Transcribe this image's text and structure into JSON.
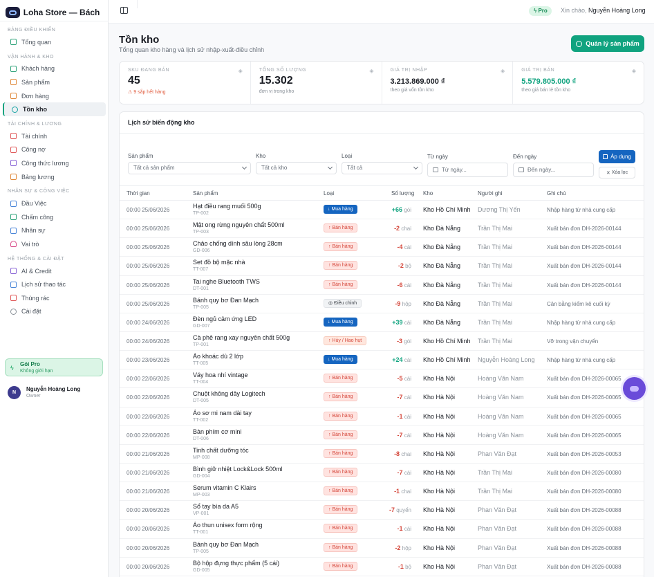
{
  "app": {
    "brand": "Loha Store — Bách hóa ..."
  },
  "sidebar": {
    "sections": [
      {
        "title": "BẢNG ĐIỀU KHIỂN",
        "items": [
          {
            "label": "Tổng quan",
            "icon": "grid-icon",
            "color": "ic-g"
          }
        ]
      },
      {
        "title": "VẬN HÀNH & KHO",
        "items": [
          {
            "label": "Khách hàng",
            "icon": "users-icon",
            "color": "ic-g"
          },
          {
            "label": "Sản phẩm",
            "icon": "box-icon",
            "color": "ic-o"
          },
          {
            "label": "Đơn hàng",
            "icon": "cart-icon",
            "color": "ic-o"
          },
          {
            "label": "Tồn kho",
            "icon": "warehouse-icon",
            "color": "ic-t",
            "active": true
          }
        ]
      },
      {
        "title": "TÀI CHÍNH & LƯƠNG",
        "items": [
          {
            "label": "Tài chính",
            "icon": "wallet-icon",
            "color": "ic-r"
          },
          {
            "label": "Công nợ",
            "icon": "receipt-icon",
            "color": "ic-r"
          },
          {
            "label": "Công thức lương",
            "icon": "formula-icon",
            "color": "ic-p"
          },
          {
            "label": "Bảng lương",
            "icon": "payroll-icon",
            "color": "ic-o"
          }
        ]
      },
      {
        "title": "NHÂN SỰ & CÔNG VIỆC",
        "items": [
          {
            "label": "Đầu Việc",
            "icon": "task-icon",
            "color": "ic-b"
          },
          {
            "label": "Chấm công",
            "icon": "calendar-icon",
            "color": "ic-g"
          },
          {
            "label": "Nhân sự",
            "icon": "people-icon",
            "color": "ic-b"
          },
          {
            "label": "Vai trò",
            "icon": "shield-icon",
            "color": "ic-pk"
          }
        ]
      },
      {
        "title": "HỆ THỐNG & CÀI ĐẶT",
        "items": [
          {
            "label": "AI & Credit",
            "icon": "sparkle-icon",
            "color": "ic-p"
          },
          {
            "label": "Lịch sử thao tác",
            "icon": "history-icon",
            "color": "ic-b"
          },
          {
            "label": "Thùng rác",
            "icon": "trash-icon",
            "color": "ic-r"
          },
          {
            "label": "Cài đặt",
            "icon": "gear-icon",
            "color": "ic-gr"
          }
        ]
      }
    ],
    "plan": {
      "title": "Gói Pro",
      "subtitle": "Không giới hạn"
    },
    "user": {
      "initial": "N",
      "name": "Nguyễn Hoàng Long",
      "role": "Owner"
    }
  },
  "topbar": {
    "pro_badge": "Pro",
    "greeting": "Xin chào,",
    "user_name": "Nguyễn Hoàng Long"
  },
  "page": {
    "title": "Tồn kho",
    "subtitle": "Tổng quan kho hàng và lịch sử nhập-xuất-điều chỉnh",
    "manage_button": "Quản lý sản phẩm"
  },
  "stats": [
    {
      "label": "SKU ĐANG BÁN",
      "value": "45",
      "sub": "9 sắp hết hàng",
      "icon": "cube-icon",
      "warn": true
    },
    {
      "label": "TỔNG SỐ LƯỢNG",
      "value": "15.302",
      "sub": "đơn vị trong kho",
      "icon": "layers-icon"
    },
    {
      "label": "GIÁ TRỊ NHẬP",
      "value": "3.213.869.000 ₫",
      "sub": "theo giá vốn tồn kho",
      "icon": "dollar-icon",
      "small": true
    },
    {
      "label": "GIÁ TRỊ BÁN",
      "value": "5.579.805.000 ₫",
      "sub": "theo giá bán lẻ tồn kho",
      "icon": "trend-up-icon",
      "small": true,
      "green": true
    }
  ],
  "history": {
    "title": "Lịch sử biến động kho",
    "filters": {
      "product_label": "Sản phẩm",
      "product_value": "Tất cả sản phẩm",
      "warehouse_label": "Kho",
      "warehouse_value": "Tất cả kho",
      "type_label": "Loại",
      "type_value": "Tất cả",
      "from_label": "Từ ngày",
      "from_placeholder": "Từ ngày...",
      "to_label": "Đến ngày",
      "to_placeholder": "Đến ngày...",
      "apply": "Áp dụng",
      "clear": "Xóa lọc"
    },
    "columns": [
      "Thời gian",
      "Sản phẩm",
      "Loại",
      "Số lượng",
      "Kho",
      "Người ghi",
      "Ghi chú"
    ],
    "rows": [
      {
        "time": "00:00 25/06/2026",
        "product": "Hạt điều rang muối 500g",
        "sku": "TP-002",
        "type": "Mua hàng",
        "kind": "buy",
        "qty": "+66",
        "unit": "gói",
        "wh": "Kho Hồ Chí Minh",
        "who": "Dương Thị Yến",
        "note": "Nhập hàng từ nhà cung cấp"
      },
      {
        "time": "00:00 25/06/2026",
        "product": "Mật ong rừng nguyên chất 500ml",
        "sku": "TP-003",
        "type": "Bán hàng",
        "kind": "sell",
        "qty": "-2",
        "unit": "chai",
        "wh": "Kho Đà Nẵng",
        "who": "Trần Thị Mai",
        "note": "Xuất bán đơn DH-2026-00144"
      },
      {
        "time": "00:00 25/06/2026",
        "product": "Chảo chống dính sâu lòng 28cm",
        "sku": "GD-006",
        "type": "Bán hàng",
        "kind": "sell",
        "qty": "-4",
        "unit": "cái",
        "wh": "Kho Đà Nẵng",
        "who": "Trần Thị Mai",
        "note": "Xuất bán đơn DH-2026-00144"
      },
      {
        "time": "00:00 25/06/2026",
        "product": "Set đồ bộ mặc nhà",
        "sku": "TT-007",
        "type": "Bán hàng",
        "kind": "sell",
        "qty": "-2",
        "unit": "bộ",
        "wh": "Kho Đà Nẵng",
        "who": "Trần Thị Mai",
        "note": "Xuất bán đơn DH-2026-00144"
      },
      {
        "time": "00:00 25/06/2026",
        "product": "Tai nghe Bluetooth TWS",
        "sku": "DT-001",
        "type": "Bán hàng",
        "kind": "sell",
        "qty": "-6",
        "unit": "cái",
        "wh": "Kho Đà Nẵng",
        "who": "Trần Thị Mai",
        "note": "Xuất bán đơn DH-2026-00144"
      },
      {
        "time": "00:00 25/06/2026",
        "product": "Bánh quy bơ Đan Mạch",
        "sku": "TP-005",
        "type": "Điều chỉnh",
        "kind": "adj",
        "qty": "-9",
        "unit": "hộp",
        "wh": "Kho Đà Nẵng",
        "who": "Trần Thị Mai",
        "note": "Cân bằng kiểm kê cuối kỳ"
      },
      {
        "time": "00:00 24/06/2026",
        "product": "Đèn ngủ cảm ứng LED",
        "sku": "GD-007",
        "type": "Mua hàng",
        "kind": "buy",
        "qty": "+39",
        "unit": "cái",
        "wh": "Kho Đà Nẵng",
        "who": "Trần Thị Mai",
        "note": "Nhập hàng từ nhà cung cấp"
      },
      {
        "time": "00:00 24/06/2026",
        "product": "Cà phê rang xay nguyên chất 500g",
        "sku": "TP-001",
        "type": "Hủy / Hao hụt",
        "kind": "loss",
        "qty": "-3",
        "unit": "gói",
        "wh": "Kho Hồ Chí Minh",
        "who": "Trần Thị Mai",
        "note": "Vỡ trong vận chuyển"
      },
      {
        "time": "00:00 23/06/2026",
        "product": "Áo khoác dù 2 lớp",
        "sku": "TT-005",
        "type": "Mua hàng",
        "kind": "buy",
        "qty": "+24",
        "unit": "cái",
        "wh": "Kho Hồ Chí Minh",
        "who": "Nguyễn Hoàng Long",
        "note": "Nhập hàng từ nhà cung cấp"
      },
      {
        "time": "00:00 22/06/2026",
        "product": "Váy hoa nhí vintage",
        "sku": "TT-004",
        "type": "Bán hàng",
        "kind": "sell",
        "qty": "-5",
        "unit": "cái",
        "wh": "Kho Hà Nội",
        "who": "Hoàng Văn Nam",
        "note": "Xuất bán đơn DH-2026-00065"
      },
      {
        "time": "00:00 22/06/2026",
        "product": "Chuột không dây Logitech",
        "sku": "DT-005",
        "type": "Bán hàng",
        "kind": "sell",
        "qty": "-7",
        "unit": "cái",
        "wh": "Kho Hà Nội",
        "who": "Hoàng Văn Nam",
        "note": "Xuất bán đơn DH-2026-00065"
      },
      {
        "time": "00:00 22/06/2026",
        "product": "Áo sơ mi nam dài tay",
        "sku": "TT-002",
        "type": "Bán hàng",
        "kind": "sell",
        "qty": "-1",
        "unit": "cái",
        "wh": "Kho Hà Nội",
        "who": "Hoàng Văn Nam",
        "note": "Xuất bán đơn DH-2026-00065"
      },
      {
        "time": "00:00 22/06/2026",
        "product": "Bàn phím cơ mini",
        "sku": "DT-006",
        "type": "Bán hàng",
        "kind": "sell",
        "qty": "-7",
        "unit": "cái",
        "wh": "Kho Hà Nội",
        "who": "Hoàng Văn Nam",
        "note": "Xuất bán đơn DH-2026-00065"
      },
      {
        "time": "00:00 21/06/2026",
        "product": "Tinh chất dưỡng tóc",
        "sku": "MP-008",
        "type": "Bán hàng",
        "kind": "sell",
        "qty": "-8",
        "unit": "chai",
        "wh": "Kho Hà Nội",
        "who": "Phan Văn Đạt",
        "note": "Xuất bán đơn DH-2026-00053"
      },
      {
        "time": "00:00 21/06/2026",
        "product": "Bình giữ nhiệt Lock&Lock 500ml",
        "sku": "GD-004",
        "type": "Bán hàng",
        "kind": "sell",
        "qty": "-7",
        "unit": "cái",
        "wh": "Kho Hà Nội",
        "who": "Trần Thị Mai",
        "note": "Xuất bán đơn DH-2026-00080"
      },
      {
        "time": "00:00 21/06/2026",
        "product": "Serum vitamin C Klairs",
        "sku": "MP-003",
        "type": "Bán hàng",
        "kind": "sell",
        "qty": "-1",
        "unit": "chai",
        "wh": "Kho Hà Nội",
        "who": "Trần Thị Mai",
        "note": "Xuất bán đơn DH-2026-00080"
      },
      {
        "time": "00:00 20/06/2026",
        "product": "Sổ tay bìa da A5",
        "sku": "VP-001",
        "type": "Bán hàng",
        "kind": "sell",
        "qty": "-7",
        "unit": "quyển",
        "wh": "Kho Hà Nội",
        "who": "Phan Văn Đạt",
        "note": "Xuất bán đơn DH-2026-00088"
      },
      {
        "time": "00:00 20/06/2026",
        "product": "Áo thun unisex form rộng",
        "sku": "TT-001",
        "type": "Bán hàng",
        "kind": "sell",
        "qty": "-1",
        "unit": "cái",
        "wh": "Kho Hà Nội",
        "who": "Phan Văn Đạt",
        "note": "Xuất bán đơn DH-2026-00088"
      },
      {
        "time": "00:00 20/06/2026",
        "product": "Bánh quy bơ Đan Mạch",
        "sku": "TP-005",
        "type": "Bán hàng",
        "kind": "sell",
        "qty": "-2",
        "unit": "hộp",
        "wh": "Kho Hà Nội",
        "who": "Phan Văn Đạt",
        "note": "Xuất bán đơn DH-2026-00088"
      },
      {
        "time": "00:00 20/06/2026",
        "product": "Bộ hộp đựng thực phẩm (5 cái)",
        "sku": "GD-005",
        "type": "Bán hàng",
        "kind": "sell",
        "qty": "-1",
        "unit": "bộ",
        "wh": "Kho Hà Nội",
        "who": "Phan Văn Đạt",
        "note": "Xuất bán đơn DH-2026-00088"
      }
    ]
  },
  "colors": {
    "accent": "#10a37f",
    "buy": "#1565c0",
    "sell": "#d4463a",
    "positive": "#10a37f",
    "negative": "#d4463a"
  }
}
